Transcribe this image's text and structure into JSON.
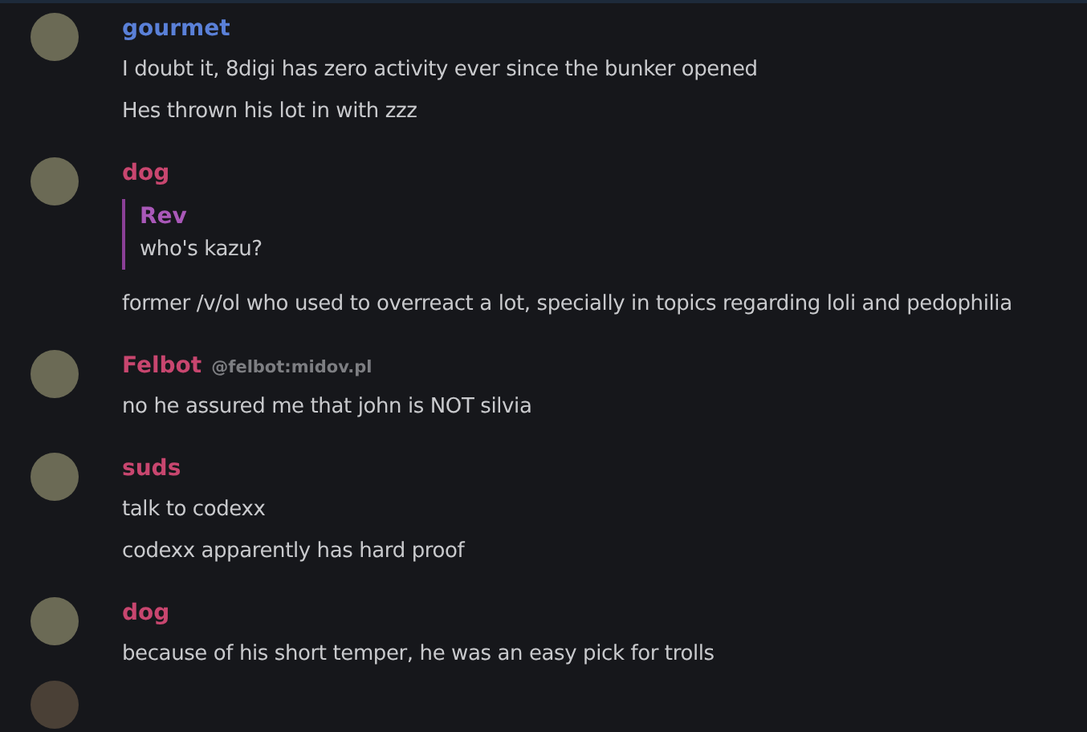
{
  "messages": [
    {
      "author": "gourmet",
      "color": "#5a80d8",
      "lines": [
        "I doubt it, 8digi has zero activity ever since the bunker opened",
        "Hes thrown his lot in with zzz"
      ]
    },
    {
      "author": "dog",
      "color": "#c8466f",
      "quote": {
        "author": "Rev",
        "color": "#a958b8",
        "text": "who's kazu?"
      },
      "lines": [
        "former /v/ol who used to overreact a lot, specially in topics regarding loli and pedophilia"
      ]
    },
    {
      "author": "Felbot",
      "color": "#c8466f",
      "handle": "@felbot:midov.pl",
      "lines": [
        "no he assured me that john is NOT silvia"
      ]
    },
    {
      "author": "suds",
      "color": "#c8466f",
      "lines": [
        "talk to codexx",
        "codexx apparently has hard proof"
      ]
    },
    {
      "author": "dog",
      "color": "#c8466f",
      "lines": [
        "because of his short temper, he was an easy pick for trolls"
      ]
    }
  ],
  "next_message_peek": true
}
